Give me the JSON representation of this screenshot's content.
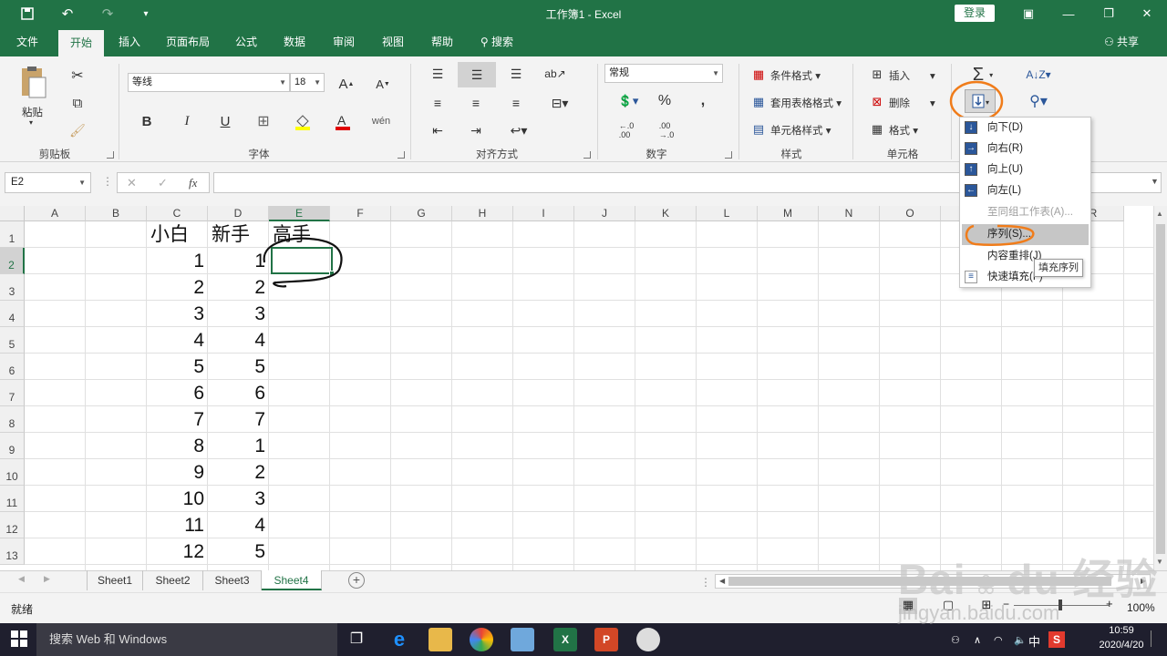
{
  "window": {
    "title": "工作簿1  -  Excel",
    "login": "登录"
  },
  "quick_access": [
    "save-icon",
    "undo-icon",
    "redo-icon",
    "customize-icon"
  ],
  "window_controls": [
    "ribbon-display-icon",
    "minimize-icon",
    "restore-icon",
    "close-icon"
  ],
  "tabs": [
    "文件",
    "开始",
    "插入",
    "页面布局",
    "公式",
    "数据",
    "审阅",
    "视图",
    "帮助",
    "搜索"
  ],
  "share": "共享",
  "ribbon": {
    "clipboard": {
      "paste": "粘贴",
      "group": "剪贴板"
    },
    "font": {
      "name": "等线",
      "size": "18",
      "bold": "B",
      "italic": "I",
      "underline": "U",
      "group": "字体"
    },
    "alignment": {
      "group": "对齐方式"
    },
    "number": {
      "format": "常规",
      "percent": "%",
      "comma": ",",
      "group": "数字"
    },
    "styles": {
      "cond": "条件格式",
      "table": "套用表格格式",
      "cell": "单元格样式",
      "group": "样式"
    },
    "cells": {
      "insert": "插入",
      "delete": "删除",
      "format": "格式",
      "group": "单元格"
    }
  },
  "formula": {
    "namebox": "E2",
    "fx": "fx"
  },
  "grid": {
    "columns": [
      "A",
      "B",
      "C",
      "D",
      "E",
      "F",
      "G",
      "H",
      "I",
      "J",
      "K",
      "L",
      "M",
      "N",
      "O",
      "P",
      "Q",
      "R"
    ],
    "rows": [
      "1",
      "2",
      "3",
      "4",
      "5",
      "6",
      "7",
      "8",
      "9",
      "10",
      "11",
      "12",
      "13"
    ],
    "c_header": "小白",
    "d_header": "新手",
    "e_header": "高手",
    "c_values": [
      "1",
      "2",
      "3",
      "4",
      "5",
      "6",
      "7",
      "8",
      "9",
      "10",
      "11",
      "12"
    ],
    "d_values": [
      "1",
      "2",
      "3",
      "4",
      "5",
      "6",
      "7",
      "1",
      "2",
      "3",
      "4",
      "5"
    ]
  },
  "fill_menu": {
    "items": [
      {
        "label": "向下(D)",
        "icon": "fill-down-icon"
      },
      {
        "label": "向右(R)",
        "icon": "fill-right-icon"
      },
      {
        "label": "向上(U)",
        "icon": "fill-up-icon"
      },
      {
        "label": "向左(L)",
        "icon": "fill-left-icon"
      },
      {
        "label": "至同组工作表(A)...",
        "icon": ""
      },
      {
        "label": "序列(S)...",
        "icon": ""
      },
      {
        "label": "内容重排(J)",
        "icon": ""
      },
      {
        "label": "快速填充(F)",
        "icon": "flash-fill-icon"
      }
    ],
    "tooltip": "填充序列"
  },
  "sheets": [
    "Sheet1",
    "Sheet2",
    "Sheet3",
    "Sheet4"
  ],
  "status": {
    "ready": "就绪",
    "zoom": "100%"
  },
  "taskbar": {
    "search": "搜索 Web 和 Windows",
    "ime": "中",
    "time": "10:59",
    "date": "2020/4/20"
  },
  "watermark": {
    "logo": "Bai du 经验",
    "url": "jingyan.baidu.com"
  },
  "colors": {
    "excel_green": "#217346",
    "highlight_orange": "#f07c1a"
  }
}
